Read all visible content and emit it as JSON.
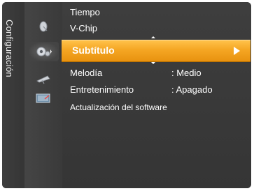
{
  "menu": {
    "section_title": "Configuración",
    "items": [
      {
        "label": "Tiempo",
        "value": ""
      },
      {
        "label": "V-Chip",
        "value": ""
      },
      {
        "label": "Subtítulo",
        "value": ""
      },
      {
        "label": "Melodía",
        "value": ": Medio"
      },
      {
        "label": "Entretenimiento",
        "value": ": Apagado"
      },
      {
        "label": "Actualización del software",
        "value": ""
      }
    ],
    "selected_index": 2
  },
  "icons": [
    "satellite-dish-icon",
    "gear-icon",
    "antenna-icon",
    "input-icon"
  ],
  "colors": {
    "background": "#3b3b3b",
    "highlight": "#f5a623",
    "text": "#ffffff"
  }
}
